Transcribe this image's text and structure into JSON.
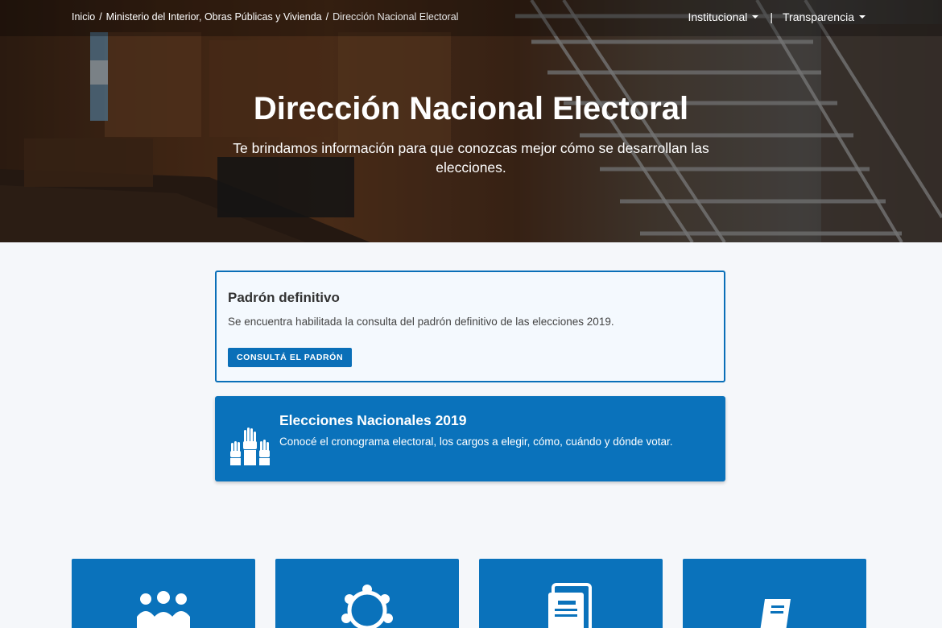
{
  "breadcrumb": {
    "items": [
      "Inicio",
      "Ministerio del Interior, Obras Públicas y Vivienda"
    ],
    "current": "Dirección Nacional Electoral",
    "separator": "/"
  },
  "nav": {
    "institucional": "Institucional",
    "divider": "|",
    "transparencia": "Transparencia"
  },
  "hero": {
    "title": "Dirección Nacional Electoral",
    "subtitle": "Te brindamos información para que conozcas mejor cómo se desarrollan las elecciones."
  },
  "notice": {
    "title": "Padrón definitivo",
    "text": "Se encuentra habilitada la consulta del padrón definitivo de las elecciones 2019.",
    "button": "CONSULTÁ EL PADRÓN"
  },
  "elections": {
    "title": "Elecciones Nacionales 2019",
    "text": "Conocé el cronograma electoral, los cargos a elegir, cómo, cuándo y dónde votar.",
    "icon": "raised-hands-icon"
  },
  "tiles": [
    {
      "icon": "people-group-icon"
    },
    {
      "icon": "network-circle-icon"
    },
    {
      "icon": "document-icon"
    },
    {
      "icon": "book-icon"
    }
  ],
  "colors": {
    "primary": "#0a72bb",
    "notice_border": "#0a6fb8",
    "page_background": "#f5f7fa"
  }
}
